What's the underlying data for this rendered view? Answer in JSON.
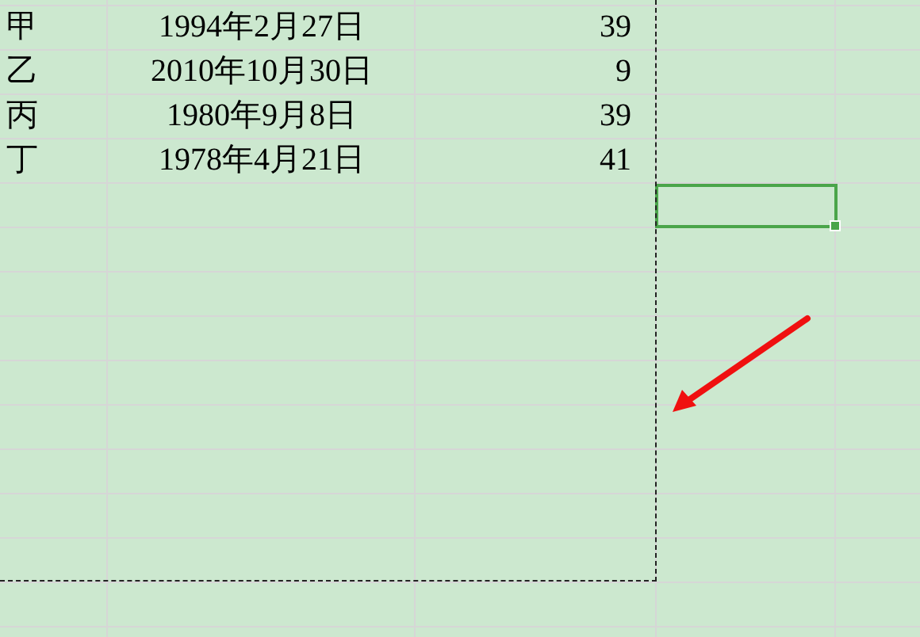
{
  "sheet": {
    "rows": [
      {
        "cells": [
          {
            "text": "甲",
            "selected": false
          },
          {
            "text": "1994年2月27日",
            "selected": false
          },
          {
            "text": "39",
            "selected": false
          },
          {
            "selected": false
          }
        ]
      },
      {
        "cells": [
          {
            "text": "乙",
            "selected": false
          },
          {
            "text": "2010年10月30日",
            "selected": false
          },
          {
            "text": "9",
            "selected": false
          },
          {
            "selected": false
          }
        ]
      },
      {
        "cells": [
          {
            "text": "丙",
            "selected": false
          },
          {
            "text": "1980年9月8日",
            "selected": false
          },
          {
            "text": "39",
            "selected": false
          },
          {
            "selected": false
          }
        ]
      },
      {
        "cells": [
          {
            "text": "丁",
            "selected": false
          },
          {
            "text": "1978年4月21日",
            "selected": false
          },
          {
            "text": "41",
            "selected": false
          },
          {
            "selected": false
          }
        ]
      },
      {
        "cells": [
          {
            "selected": false
          },
          {
            "selected": false
          },
          {
            "selected": false
          },
          {
            "selected": true
          }
        ]
      }
    ]
  }
}
